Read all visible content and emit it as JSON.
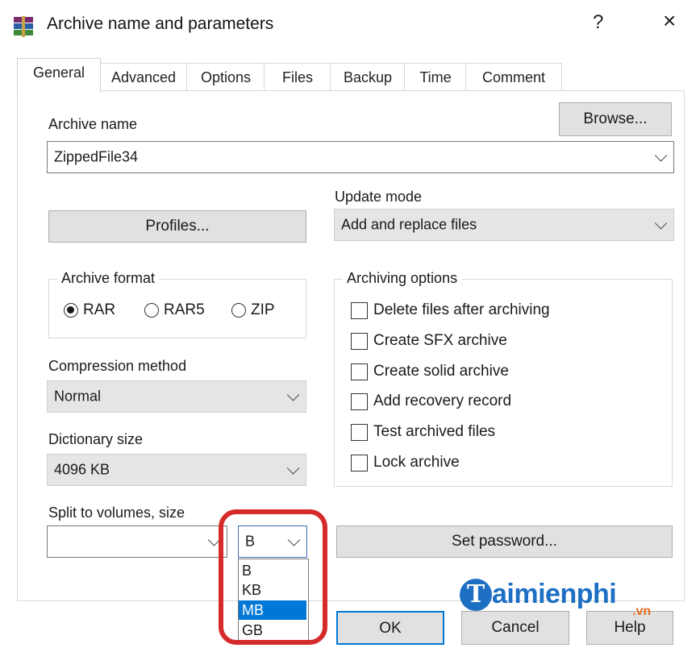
{
  "window": {
    "title": "Archive name and parameters",
    "help_label": "?",
    "close_label": "×"
  },
  "tabs": [
    "General",
    "Advanced",
    "Options",
    "Files",
    "Backup",
    "Time",
    "Comment"
  ],
  "general": {
    "archive_name_label": "Archive name",
    "browse_label": "Browse...",
    "archive_name_value": "ZippedFile34",
    "update_mode_label": "Update mode",
    "update_mode_value": "Add and replace files",
    "profiles_label": "Profiles...",
    "archive_format": {
      "title": "Archive format",
      "options": [
        "RAR",
        "RAR5",
        "ZIP"
      ],
      "selected": "RAR"
    },
    "archiving_options": {
      "title": "Archiving options",
      "items": [
        "Delete files after archiving",
        "Create SFX archive",
        "Create solid archive",
        "Add recovery record",
        "Test archived files",
        "Lock archive"
      ]
    },
    "compression_method_label": "Compression method",
    "compression_method_value": "Normal",
    "dictionary_size_label": "Dictionary size",
    "dictionary_size_value": "4096 KB",
    "split_label": "Split to volumes, size",
    "split_value": "",
    "unit_value": "B",
    "unit_options": [
      "B",
      "KB",
      "MB",
      "GB"
    ],
    "unit_highlighted": "MB",
    "set_password_label": "Set password..."
  },
  "footer": {
    "ok_label": "OK",
    "cancel_label": "Cancel",
    "help_label": "Help"
  },
  "watermark": {
    "logo_letter": "T",
    "text": "aimienphi",
    "sub": ".vn"
  },
  "colors": {
    "selection": "#0078d7",
    "highlight_ring": "#d62b2b",
    "watermark_blue": "#1d6fc4",
    "watermark_orange": "#e27022"
  }
}
